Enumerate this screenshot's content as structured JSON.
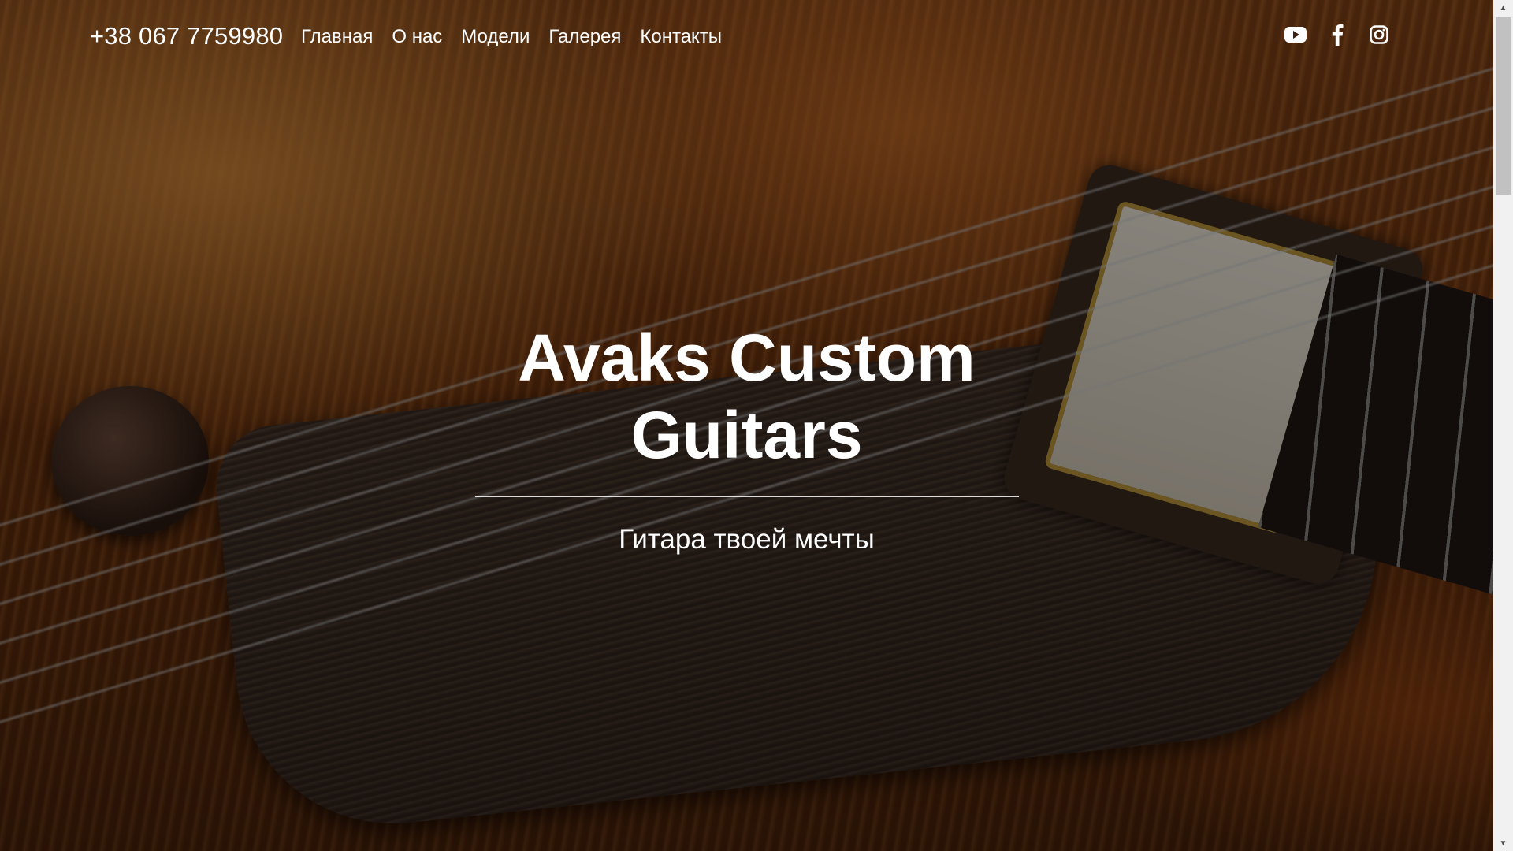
{
  "header": {
    "phone": "+38 067 7759980",
    "nav": [
      {
        "label": "Главная"
      },
      {
        "label": "О нас"
      },
      {
        "label": "Модели"
      },
      {
        "label": "Галерея"
      },
      {
        "label": "Контакты"
      }
    ],
    "social": [
      {
        "icon": "youtube-icon"
      },
      {
        "icon": "facebook-icon"
      },
      {
        "icon": "instagram-icon"
      }
    ]
  },
  "hero": {
    "title_line1": "Avaks Custom",
    "title_line2": "Guitars",
    "subtitle": "Гитара твоей мечты"
  },
  "colors": {
    "text": "#ffffff",
    "scrollbar_track": "#f1f1f1",
    "scrollbar_thumb": "#c1c1c1"
  }
}
